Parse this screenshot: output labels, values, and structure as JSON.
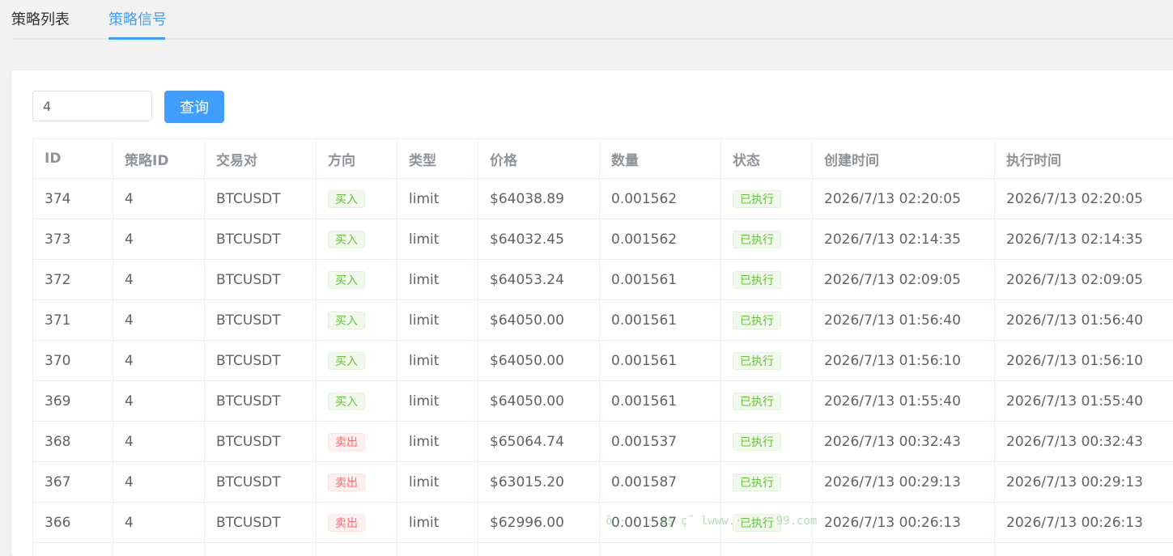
{
  "tabs": [
    {
      "label": "策略列表",
      "active": false
    },
    {
      "label": "策略信号",
      "active": true
    }
  ],
  "search": {
    "value": "4"
  },
  "query_button": {
    "label": "查询"
  },
  "table": {
    "columns": [
      "ID",
      "策略ID",
      "交易对",
      "方向",
      "类型",
      "价格",
      "数量",
      "状态",
      "创建时间",
      "执行时间"
    ],
    "rows": [
      {
        "id": "374",
        "strategy_id": "4",
        "pair": "BTCUSDT",
        "direction": "买入",
        "dir_kind": "buy",
        "type": "limit",
        "price": "$64038.89",
        "qty": "0.001562",
        "status": "已执行",
        "created": "2026/7/13 02:20:05",
        "executed": "2026/7/13 02:20:05"
      },
      {
        "id": "373",
        "strategy_id": "4",
        "pair": "BTCUSDT",
        "direction": "买入",
        "dir_kind": "buy",
        "type": "limit",
        "price": "$64032.45",
        "qty": "0.001562",
        "status": "已执行",
        "created": "2026/7/13 02:14:35",
        "executed": "2026/7/13 02:14:35"
      },
      {
        "id": "372",
        "strategy_id": "4",
        "pair": "BTCUSDT",
        "direction": "买入",
        "dir_kind": "buy",
        "type": "limit",
        "price": "$64053.24",
        "qty": "0.001561",
        "status": "已执行",
        "created": "2026/7/13 02:09:05",
        "executed": "2026/7/13 02:09:05"
      },
      {
        "id": "371",
        "strategy_id": "4",
        "pair": "BTCUSDT",
        "direction": "买入",
        "dir_kind": "buy",
        "type": "limit",
        "price": "$64050.00",
        "qty": "0.001561",
        "status": "已执行",
        "created": "2026/7/13 01:56:40",
        "executed": "2026/7/13 01:56:40"
      },
      {
        "id": "370",
        "strategy_id": "4",
        "pair": "BTCUSDT",
        "direction": "买入",
        "dir_kind": "buy",
        "type": "limit",
        "price": "$64050.00",
        "qty": "0.001561",
        "status": "已执行",
        "created": "2026/7/13 01:56:10",
        "executed": "2026/7/13 01:56:10"
      },
      {
        "id": "369",
        "strategy_id": "4",
        "pair": "BTCUSDT",
        "direction": "买入",
        "dir_kind": "buy",
        "type": "limit",
        "price": "$64050.00",
        "qty": "0.001561",
        "status": "已执行",
        "created": "2026/7/13 01:55:40",
        "executed": "2026/7/13 01:55:40"
      },
      {
        "id": "368",
        "strategy_id": "4",
        "pair": "BTCUSDT",
        "direction": "卖出",
        "dir_kind": "sell",
        "type": "limit",
        "price": "$65064.74",
        "qty": "0.001537",
        "status": "已执行",
        "created": "2026/7/13 00:32:43",
        "executed": "2026/7/13 00:32:43"
      },
      {
        "id": "367",
        "strategy_id": "4",
        "pair": "BTCUSDT",
        "direction": "卖出",
        "dir_kind": "sell",
        "type": "limit",
        "price": "$63015.20",
        "qty": "0.001587",
        "status": "已执行",
        "created": "2026/7/13 00:29:13",
        "executed": "2026/7/13 00:29:13"
      },
      {
        "id": "366",
        "strategy_id": "4",
        "pair": "BTCUSDT",
        "direction": "卖出",
        "dir_kind": "sell",
        "type": "limit",
        "price": "$62996.00",
        "qty": "0.001587",
        "status": "已执行",
        "created": "2026/7/13 00:26:13",
        "executed": "2026/7/13 00:26:13"
      },
      {
        "id": "",
        "strategy_id": "",
        "pair": "",
        "direction": "",
        "dir_kind": "",
        "type": "",
        "price": "",
        "qty": "",
        "status": "",
        "created": "",
        "executed": ""
      }
    ]
  },
  "watermark": "ô  ·  ·  ·  ćş ç˝ lwww.·  ·  ·  99.com",
  "colors": {
    "accent": "#409eff",
    "buy": "#67c23a",
    "sell": "#f56c6c"
  }
}
